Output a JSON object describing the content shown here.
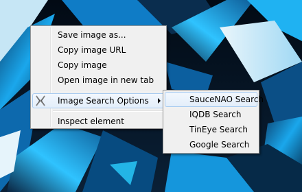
{
  "context_menu": {
    "items": [
      {
        "label": "Save image as..."
      },
      {
        "label": "Copy image URL"
      },
      {
        "label": "Copy image"
      },
      {
        "label": "Open image in new tab"
      },
      {
        "label": "Image Search Options",
        "icon": "image-search-extension-icon",
        "has_submenu": true
      },
      {
        "label": "Inspect element"
      }
    ]
  },
  "submenu": {
    "items": [
      {
        "label": "SauceNAO Search"
      },
      {
        "label": "IQDB Search"
      },
      {
        "label": "TinEye Search"
      },
      {
        "label": "Google Search"
      }
    ]
  },
  "colors": {
    "menu_background": "#f0f0f0",
    "menu_border": "#979797",
    "highlight_border": "#a8cbf0",
    "wallpaper_accent": "#19a8ee"
  }
}
